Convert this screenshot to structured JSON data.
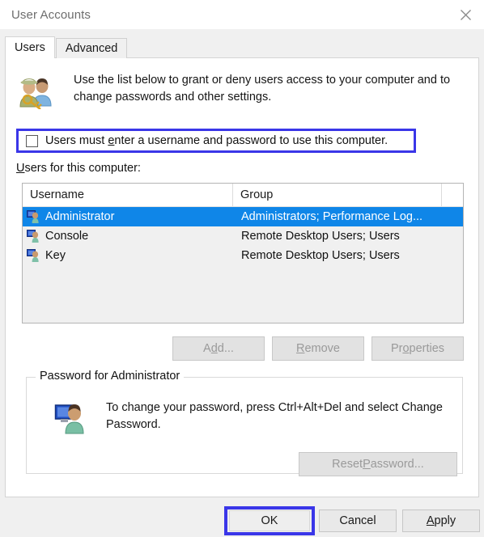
{
  "window": {
    "title": "User Accounts",
    "close_icon": "close-icon"
  },
  "tabs": [
    {
      "label": "Users",
      "active": true
    },
    {
      "label": "Advanced",
      "active": false
    }
  ],
  "users_tab": {
    "description": "Use the list below to grant or deny users access to your computer and to change passwords and other settings.",
    "header_icon": "two-users-key-icon",
    "require_login_checkbox": {
      "label_before": "Users must ",
      "label_accel": "e",
      "label_after": "nter a username and password to use this computer.",
      "checked": false,
      "highlighted": true,
      "highlight_color": "#3a36e8"
    },
    "list_caption_accel": "U",
    "list_caption_rest": "sers for this computer:",
    "list": {
      "columns": [
        "Username",
        "Group"
      ],
      "selection_color": "#0f86e8",
      "rows": [
        {
          "username": "Administrator",
          "group": "Administrators; Performance Log...",
          "icon": "user-icon",
          "selected": true
        },
        {
          "username": "Console",
          "group": "Remote Desktop Users; Users",
          "icon": "user-icon",
          "selected": false
        },
        {
          "username": "Key",
          "group": "Remote Desktop Users; Users",
          "icon": "user-icon",
          "selected": false
        }
      ]
    },
    "actions": [
      {
        "name": "add-button",
        "before": "A",
        "accel": "d",
        "after": "d...",
        "enabled": false
      },
      {
        "name": "remove-button",
        "before": "",
        "accel": "R",
        "after": "emove",
        "enabled": false
      },
      {
        "name": "properties-button",
        "before": "Pr",
        "accel": "o",
        "after": "perties",
        "enabled": false
      }
    ],
    "password_group": {
      "legend": "Password for Administrator",
      "icon": "user-monitor-icon",
      "text": "To change your password, press Ctrl+Alt+Del and select Change Password.",
      "reset_button": {
        "before": "Reset ",
        "accel": "P",
        "after": "assword...",
        "enabled": false
      }
    }
  },
  "footer": {
    "ok": {
      "label": "OK",
      "highlighted": true,
      "highlight_color": "#3a36e8"
    },
    "cancel": {
      "label": "Cancel"
    },
    "apply": {
      "accel": "A",
      "rest": "pply"
    }
  }
}
